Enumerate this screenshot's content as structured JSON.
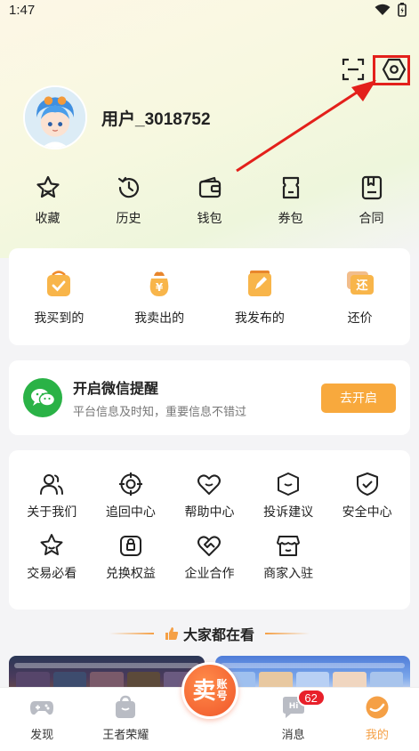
{
  "status": {
    "time": "1:47"
  },
  "profile": {
    "username": "用户_3018752"
  },
  "quick_actions": [
    {
      "label": "收藏",
      "icon": "star-icon"
    },
    {
      "label": "历史",
      "icon": "history-icon"
    },
    {
      "label": "钱包",
      "icon": "wallet-icon"
    },
    {
      "label": "券包",
      "icon": "coupon-icon"
    },
    {
      "label": "合同",
      "icon": "contract-icon"
    }
  ],
  "orders": [
    {
      "label": "我买到的",
      "icon": "bought-icon"
    },
    {
      "label": "我卖出的",
      "icon": "sold-icon"
    },
    {
      "label": "我发布的",
      "icon": "published-icon"
    },
    {
      "label": "还价",
      "icon": "counter-offer-icon",
      "glyph": "还"
    }
  ],
  "wechat": {
    "title": "开启微信提醒",
    "subtitle": "平台信息及时知，重要信息不错过",
    "button": "去开启"
  },
  "services": [
    [
      {
        "label": "关于我们",
        "icon": "users-icon"
      },
      {
        "label": "追回中心",
        "icon": "target-icon"
      },
      {
        "label": "帮助中心",
        "icon": "heart-icon"
      },
      {
        "label": "投诉建议",
        "icon": "complaint-icon"
      },
      {
        "label": "安全中心",
        "icon": "shield-icon"
      }
    ],
    [
      {
        "label": "交易必看",
        "icon": "star-outline-icon"
      },
      {
        "label": "兑换权益",
        "icon": "redeem-icon"
      },
      {
        "label": "企业合作",
        "icon": "handshake-icon"
      },
      {
        "label": "商家入驻",
        "icon": "store-icon"
      }
    ]
  ],
  "section": {
    "title": "大家都在看"
  },
  "tabbar": {
    "tabs": [
      {
        "label": "发现",
        "icon": "gamepad-icon"
      },
      {
        "label": "王者荣耀",
        "icon": "bag-icon"
      },
      {
        "label": "消息",
        "icon": "message-icon",
        "badge": "62"
      },
      {
        "label": "我的",
        "icon": "profile-icon",
        "active": true
      }
    ],
    "center": {
      "main": "卖",
      "sub1": "账",
      "sub2": "号"
    }
  },
  "colors": {
    "accent": "#f5a046",
    "highlight": "#e3201b",
    "wechat": "#2ab246",
    "badge": "#e8202a"
  }
}
